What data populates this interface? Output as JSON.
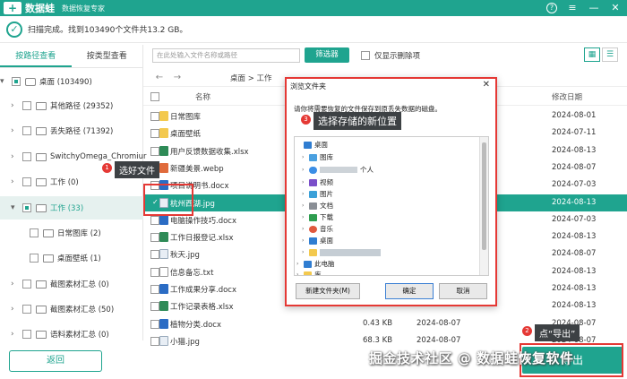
{
  "app": {
    "brand": "数据蛙",
    "subtitle": "数据恢复专家",
    "status": "扫描完成。找到103490个文件共13.2 GB。"
  },
  "left_tabs": [
    "按路径查看",
    "按类型查看"
  ],
  "tree": [
    {
      "label": "桌面 (103490)"
    },
    {
      "label": "其他路径 (29352)"
    },
    {
      "label": "丢失路径 (71392)"
    },
    {
      "label": "SwitchyOmega_Chromiur"
    },
    {
      "label": "工作 (0)"
    },
    {
      "label": "工作 (33)"
    },
    {
      "label": "日常图库 (2)"
    },
    {
      "label": "桌面壁纸 (1)"
    },
    {
      "label": "截图素材汇总 (0)"
    },
    {
      "label": "截图素材汇总 (50)"
    },
    {
      "label": "语料素材汇总 (0)"
    }
  ],
  "back_label": "返回",
  "toolbar": {
    "search_placeholder": "在此处输入文件名称或路径",
    "filter_label": "筛选器",
    "only_deleted_label": "仅显示删除项"
  },
  "breadcrumb": "桌面 > 工作",
  "table": {
    "col_name": "名称",
    "col_modified": "修改日期",
    "rows": [
      {
        "name": "日常图库",
        "type": "folder",
        "size": "",
        "date": "",
        "modified": "2024-08-01"
      },
      {
        "name": "桌面壁纸",
        "type": "folder",
        "size": "",
        "date": "",
        "modified": "2024-07-11"
      },
      {
        "name": "用户反馈数据收集.xlsx",
        "type": "xlsx",
        "size": "",
        "date": "",
        "modified": "2024-08-13"
      },
      {
        "name": "新疆美景.webp",
        "type": "webp",
        "size": "",
        "date": "",
        "modified": "2024-08-07"
      },
      {
        "name": "项目说明书.docx",
        "type": "docx",
        "size": "",
        "date": "",
        "modified": "2024-07-03"
      },
      {
        "name": "杭州西湖.jpg",
        "type": "img",
        "size": "",
        "date": "",
        "modified": "2024-08-13",
        "selected": true
      },
      {
        "name": "电脑操作技巧.docx",
        "type": "docx",
        "size": "",
        "date": "",
        "modified": "2024-07-03"
      },
      {
        "name": "工作日报登记.xlsx",
        "type": "xlsx",
        "size": "",
        "date": "",
        "modified": "2024-08-13"
      },
      {
        "name": "秋天.jpg",
        "type": "img",
        "size": "",
        "date": "",
        "modified": "2024-08-07"
      },
      {
        "name": "信息备忘.txt",
        "type": "txt",
        "size": "",
        "date": "",
        "modified": "2024-08-13"
      },
      {
        "name": "工作成果分享.docx",
        "type": "docx",
        "size": "",
        "date": "",
        "modified": "2024-08-13"
      },
      {
        "name": "工作记录表格.xlsx",
        "type": "xlsx",
        "size": "",
        "date": "",
        "modified": "2024-08-13"
      },
      {
        "name": "植物分类.docx",
        "type": "docx",
        "size": "0.43 KB",
        "date": "2024-08-07",
        "modified": "2024-08-07"
      },
      {
        "name": "小猫.jpg",
        "type": "img",
        "size": "68.3 KB",
        "date": "2024-08-07",
        "modified": "2024-08-07"
      }
    ]
  },
  "dialog": {
    "title": "浏览文件夹",
    "desc": "请你将需要恢复的文件保存到原丢失数据的磁盘。",
    "nodes": [
      {
        "label": "桌面"
      },
      {
        "label": "图库"
      },
      {
        "label": "个人"
      },
      {
        "label": "视频"
      },
      {
        "label": "图片"
      },
      {
        "label": "文档"
      },
      {
        "label": "下载"
      },
      {
        "label": "音乐"
      },
      {
        "label": "桌面"
      },
      {
        "label": ""
      },
      {
        "label": "此电脑"
      },
      {
        "label": "库"
      }
    ],
    "new_folder": "新建文件夹(M)",
    "ok": "确定",
    "cancel": "取消"
  },
  "annotations": {
    "step1": "选好文件",
    "step2": "点“导出”",
    "step3": "选择存储的新位置",
    "n1": "1",
    "n2": "2",
    "n3": "3"
  },
  "export_label": "导出",
  "watermark": "掘金技术社区 @ 数据蛙恢复软件",
  "colors": {
    "accent": "#1fa48f",
    "annotation": "#e53935"
  }
}
